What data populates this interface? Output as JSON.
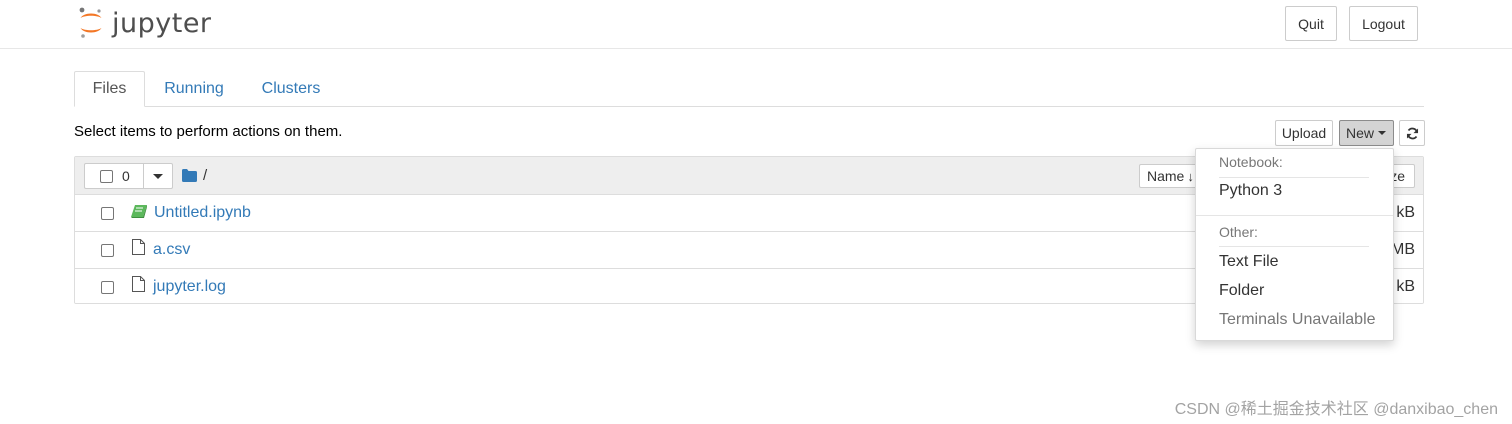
{
  "app": {
    "brand": "jupyter",
    "brand_color": "#f37726"
  },
  "header": {
    "quit_label": "Quit",
    "logout_label": "Logout"
  },
  "tabs": [
    {
      "label": "Files",
      "active": true
    },
    {
      "label": "Running",
      "active": false
    },
    {
      "label": "Clusters",
      "active": false
    }
  ],
  "toolbar": {
    "hint": "Select items to perform actions on them.",
    "upload_label": "Upload",
    "new_label": "New",
    "refresh_icon": "refresh-icon"
  },
  "list_header": {
    "selected_count": "0",
    "breadcrumb_root": "/",
    "name_sort_label": "Name",
    "size_label": "ze"
  },
  "files": [
    {
      "name": "Untitled.ipynb",
      "type": "notebook",
      "icon": "notebook-icon",
      "size_partial": "kB"
    },
    {
      "name": "a.csv",
      "type": "file",
      "icon": "file-icon",
      "size_partial": "MB"
    },
    {
      "name": "jupyter.log",
      "type": "file",
      "icon": "file-icon",
      "size_partial": "kB"
    }
  ],
  "new_menu": {
    "notebook_header": "Notebook:",
    "python3": "Python 3",
    "other_header": "Other:",
    "text_file": "Text File",
    "folder": "Folder",
    "terminals": "Terminals Unavailable"
  },
  "colors": {
    "link": "#337ab7",
    "notebook_icon": "#5cb85c",
    "folder_icon": "#337ab7"
  },
  "watermark": "CSDN @稀土掘金技术社区 @danxibao_chen"
}
